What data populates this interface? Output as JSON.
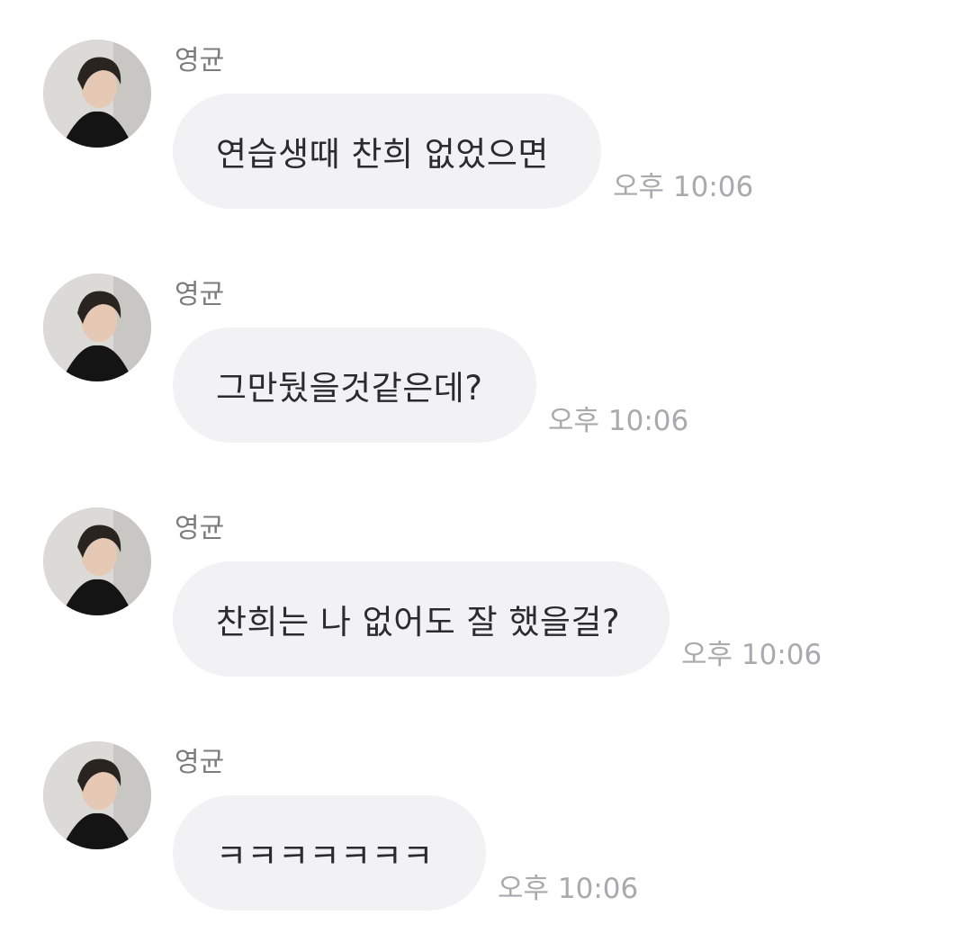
{
  "messages": [
    {
      "sender": "영균",
      "text": "연습생때 찬희 없었으면",
      "time": "오후 10:06",
      "avatar": "profile-photo"
    },
    {
      "sender": "영균",
      "text": "그만뒀을것같은데?",
      "time": "오후 10:06",
      "avatar": "profile-photo"
    },
    {
      "sender": "영균",
      "text": "찬희는 나 없어도 잘 했을걸?",
      "time": "오후 10:06",
      "avatar": "profile-photo"
    },
    {
      "sender": "영균",
      "text": "ㅋㅋㅋㅋㅋㅋㅋ",
      "time": "오후 10:06",
      "avatar": "profile-photo"
    }
  ],
  "colors": {
    "bubble_bg": "#f2f2f4",
    "sender_text": "#7c7c80",
    "time_text": "#a9a9ae",
    "message_text": "#2b2b2f"
  }
}
